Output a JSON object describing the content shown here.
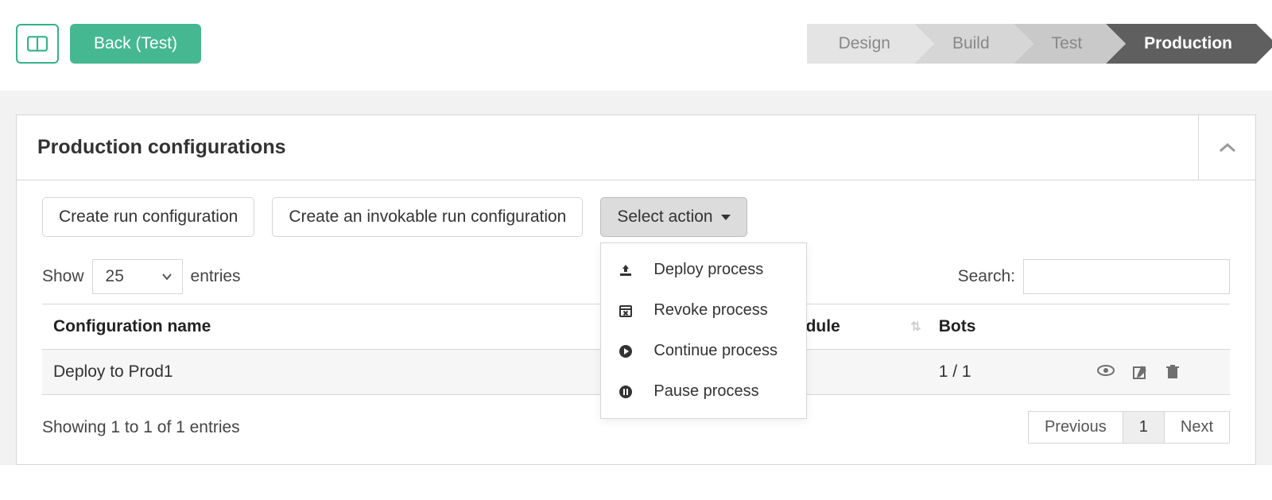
{
  "header": {
    "back_label": "Back (Test)"
  },
  "pipeline": {
    "steps": [
      "Design",
      "Build",
      "Test",
      "Production"
    ],
    "active_index": 3
  },
  "panel": {
    "title": "Production configurations"
  },
  "toolbar": {
    "create_run_label": "Create run configuration",
    "create_invokable_label": "Create an invokable run configuration",
    "select_action_label": "Select action",
    "dropdown": [
      {
        "icon": "upload-icon",
        "label": "Deploy process"
      },
      {
        "icon": "calendar-x-icon",
        "label": "Revoke process"
      },
      {
        "icon": "play-circle-icon",
        "label": "Continue process"
      },
      {
        "icon": "pause-circle-icon",
        "label": "Pause process"
      }
    ]
  },
  "table": {
    "show_label_pre": "Show",
    "show_label_post": "entries",
    "page_size": "25",
    "search_label": "Search:",
    "columns": {
      "name": "Configuration name",
      "schedule": "Schedule",
      "bots": "Bots"
    },
    "rows": [
      {
        "name": "Deploy to Prod1",
        "schedule": "",
        "bots": "1 / 1"
      }
    ],
    "info": "Showing 1 to 1 of 1 entries",
    "pager": {
      "prev": "Previous",
      "next": "Next",
      "current": "1"
    }
  }
}
